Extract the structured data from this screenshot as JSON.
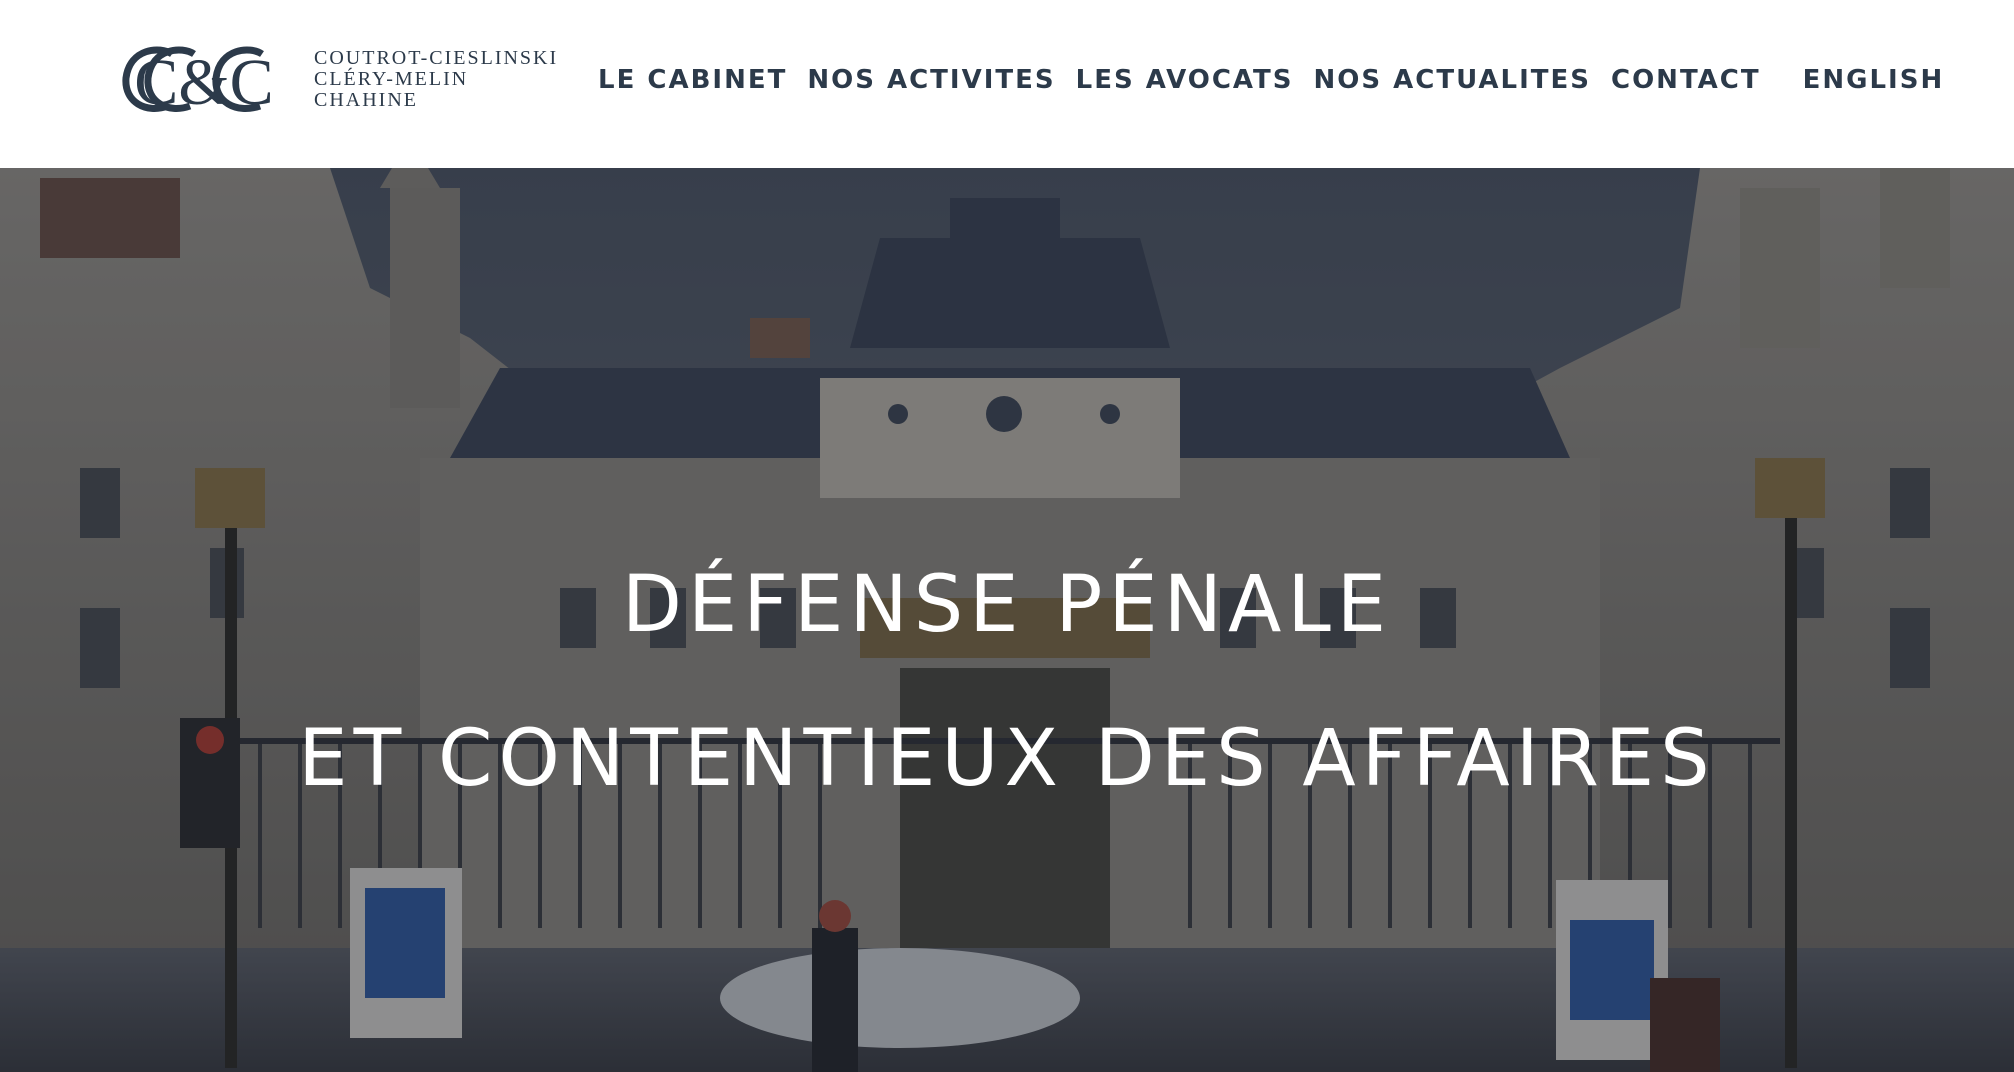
{
  "header": {
    "logo": {
      "monogram": "C&C",
      "lines": [
        "COUTROT-CIESLINSKI",
        "CLÉRY-MELIN",
        "CHAHINE"
      ]
    },
    "nav": [
      {
        "label": "LE CABINET"
      },
      {
        "label": "NOS ACTIVITES"
      },
      {
        "label": "LES AVOCATS"
      },
      {
        "label": "NOS ACTUALITES"
      },
      {
        "label": "CONTACT"
      }
    ],
    "language": "ENGLISH"
  },
  "hero": {
    "title_lines": [
      "DÉFENSE PÉNALE",
      "ET CONTENTIEUX DES AFFAIRES"
    ],
    "overlay_color": "#161a24",
    "image_subject": "palais-de-justice-paris-facade"
  },
  "colors": {
    "brand_navy": "#2c3a4a",
    "header_bg": "#ffffff",
    "hero_text": "#ffffff"
  }
}
